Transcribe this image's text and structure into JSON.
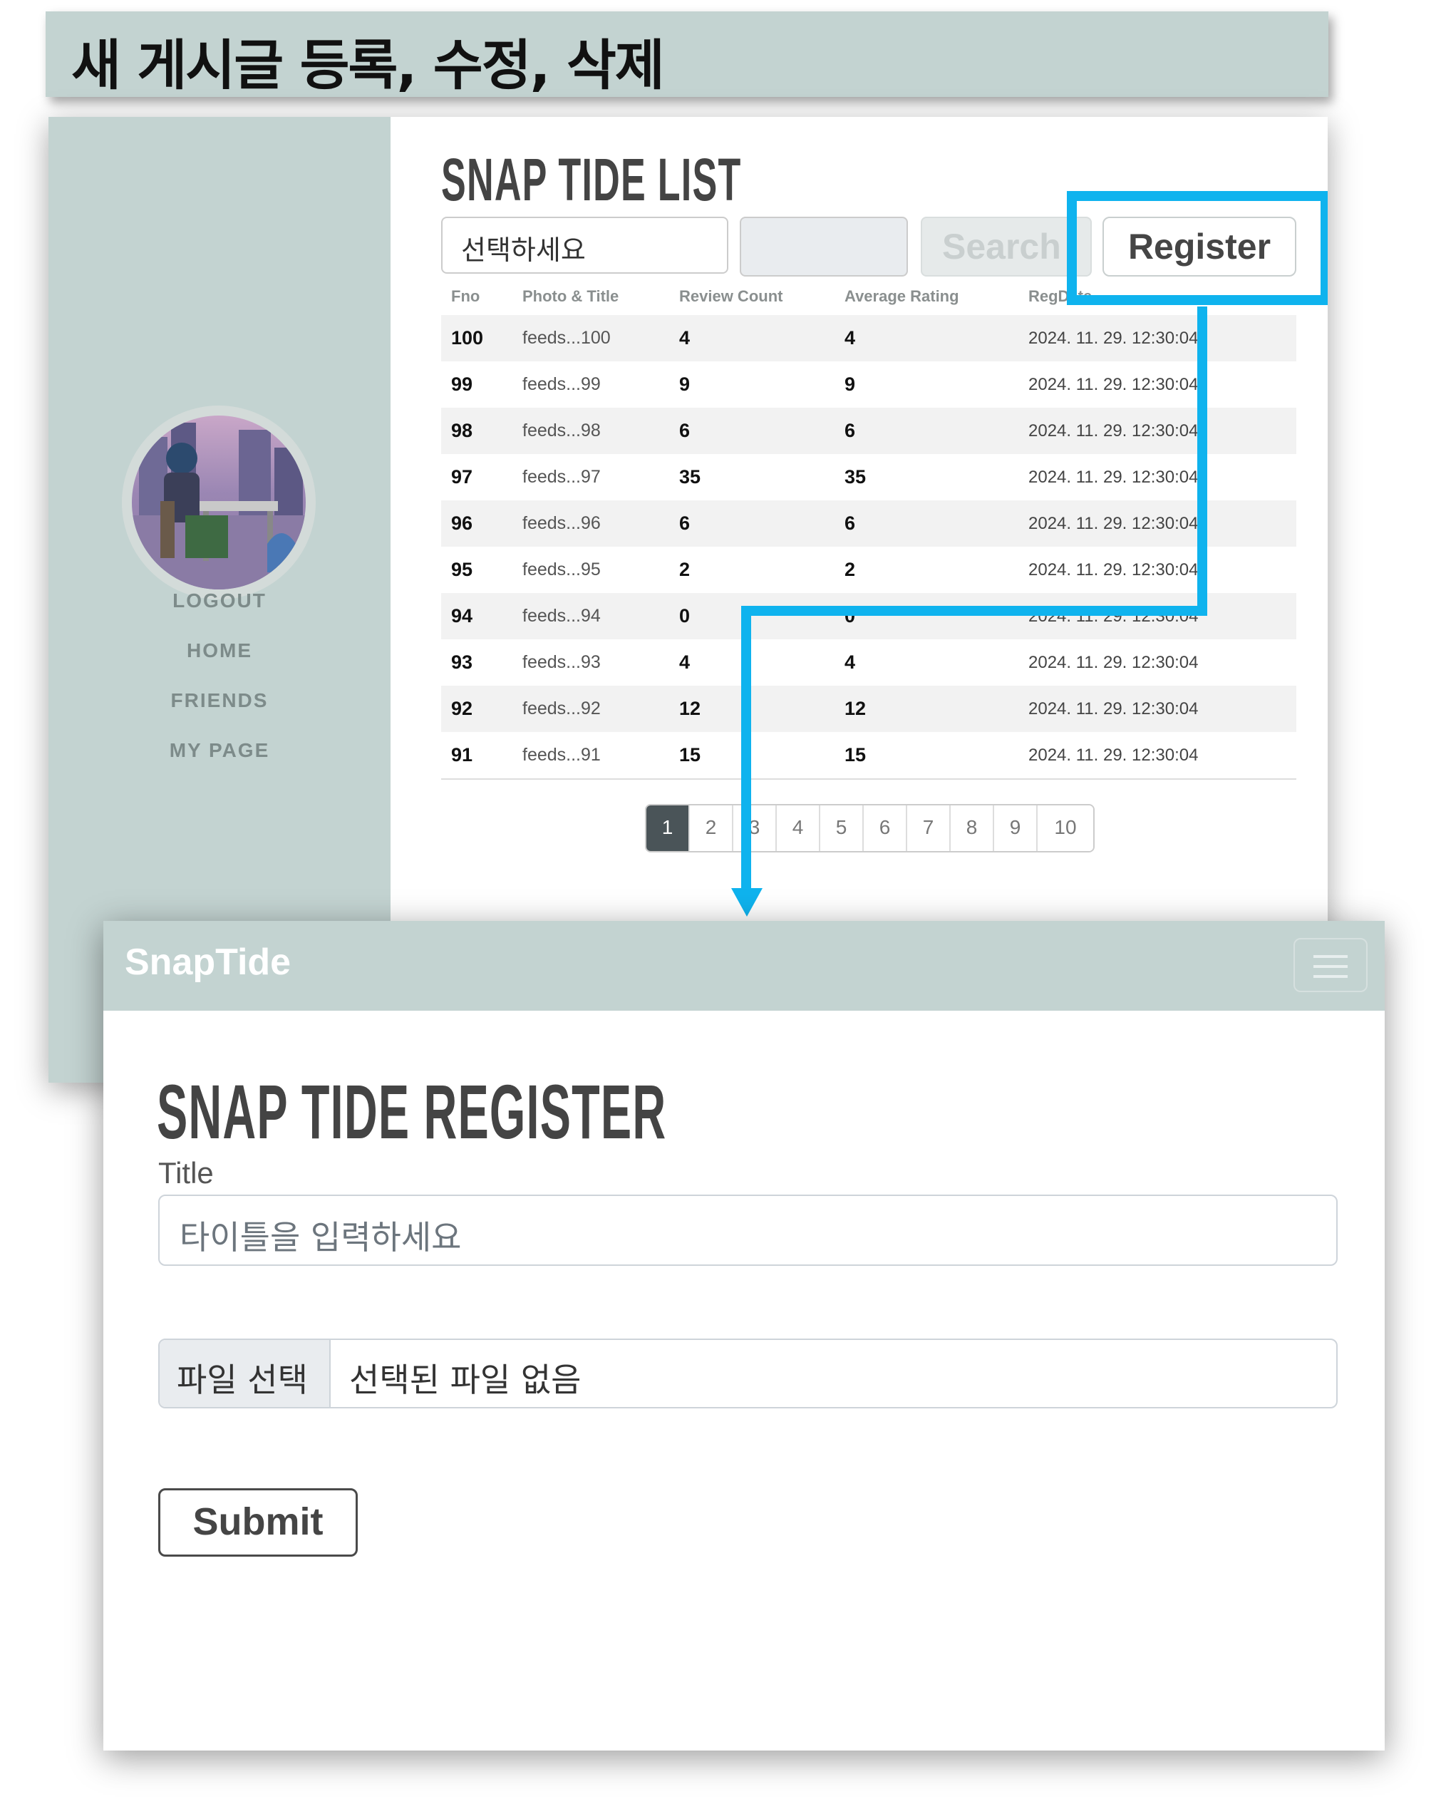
{
  "banner": {
    "title": "새 게시글 등록, 수정, 삭제"
  },
  "list_page": {
    "title": "SNAP TIDE  LIST",
    "sidebar": {
      "items": [
        "LOGOUT",
        "HOME",
        "FRIENDS",
        "MY PAGE"
      ]
    },
    "search": {
      "type_select_value": "선택하세요",
      "keyword_value": "",
      "search_label": "Search",
      "register_label": "Register"
    },
    "table": {
      "headers": [
        "Fno",
        "Photo & Title",
        "Review Count",
        "Average Rating",
        "RegDate"
      ],
      "rows": [
        [
          "100",
          "feeds...100",
          "4",
          "4",
          "2024. 11. 29. 12:30:04"
        ],
        [
          "99",
          "feeds...99",
          "9",
          "9",
          "2024. 11. 29. 12:30:04"
        ],
        [
          "98",
          "feeds...98",
          "6",
          "6",
          "2024. 11. 29. 12:30:04"
        ],
        [
          "97",
          "feeds...97",
          "35",
          "35",
          "2024. 11. 29. 12:30:04"
        ],
        [
          "96",
          "feeds...96",
          "6",
          "6",
          "2024. 11. 29. 12:30:04"
        ],
        [
          "95",
          "feeds...95",
          "2",
          "2",
          "2024. 11. 29. 12:30:04"
        ],
        [
          "94",
          "feeds...94",
          "0",
          "0",
          "2024. 11. 29. 12:30:04"
        ],
        [
          "93",
          "feeds...93",
          "4",
          "4",
          "2024. 11. 29. 12:30:04"
        ],
        [
          "92",
          "feeds...92",
          "12",
          "12",
          "2024. 11. 29. 12:30:04"
        ],
        [
          "91",
          "feeds...91",
          "15",
          "15",
          "2024. 11. 29. 12:30:04"
        ]
      ]
    },
    "pagination": {
      "pages": [
        "1",
        "2",
        "3",
        "4",
        "5",
        "6",
        "7",
        "8",
        "9",
        "10"
      ],
      "active": "1"
    }
  },
  "register_page": {
    "brand": "SnapTide",
    "title": "SNAP TIDE  REGISTER",
    "title_label": "Title",
    "title_placeholder": "타이틀을 입력하세요",
    "file_button": "파일 선택",
    "file_status": "선택된 파일 없음",
    "submit_label": "Submit"
  },
  "colors": {
    "accent_highlight": "#0fb3ee",
    "sidebar_bg": "#c3d3d1",
    "pager_active": "#4a5458"
  },
  "icons": {
    "menu": "hamburger-icon",
    "arrow": "arrow-down-icon"
  }
}
